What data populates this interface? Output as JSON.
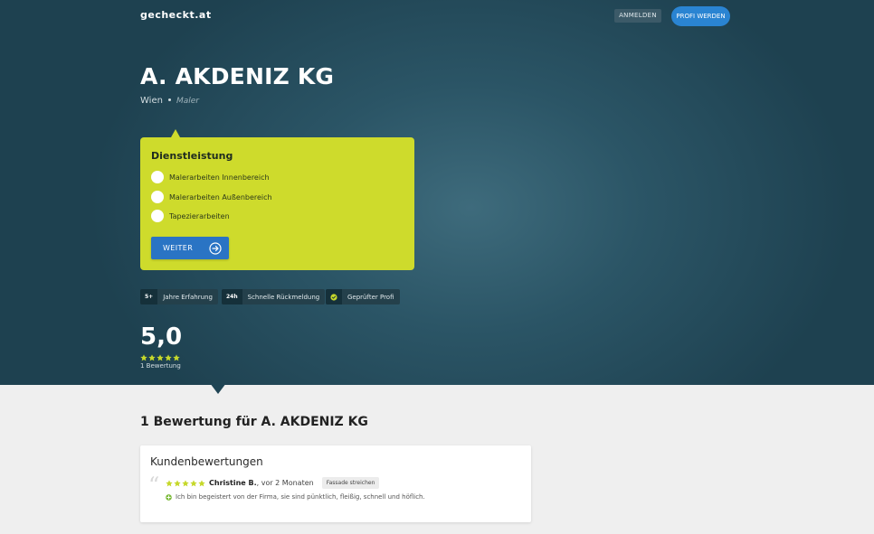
{
  "header": {
    "logo": "gecheckt.at",
    "login_label": "ANMELDEN",
    "pro_label": "PROFI WERDEN"
  },
  "company": {
    "name": "A. AKDENIZ KG",
    "city": "Wien",
    "category": "Maler"
  },
  "service_form": {
    "title": "Dienstleistung",
    "options": [
      {
        "label": "Malerarbeiten Innenbereich"
      },
      {
        "label": "Malerarbeiten Außenbereich"
      },
      {
        "label": "Tapezierarbeiten"
      }
    ],
    "submit_label": "WEITER"
  },
  "badges": [
    {
      "key": "5+",
      "label": "Jahre Erfahrung"
    },
    {
      "key": "24h",
      "label": "Schnelle Rückmeldung"
    },
    {
      "key": "check-icon",
      "label": "Geprüfter Profi"
    }
  ],
  "rating": {
    "score": "5,0",
    "stars": 5,
    "count_label": "1 Bewertung"
  },
  "reviews_section": {
    "title": "1 Bewertung für A. AKDENIZ KG",
    "card_heading": "Kundenbewertungen",
    "reviews": [
      {
        "stars": 5,
        "author": "Christine B.",
        "time": ", vor 2 Monaten",
        "tag": "Fassade streichen",
        "text": "Ich bin begeistert von der Firma, sie sind pünktlich, fleißig, schnell und höflich."
      }
    ]
  },
  "colors": {
    "accent_lime": "#cedb2c",
    "button_blue": "#2a74c4",
    "pro_blue": "#2a84d2",
    "star_lime": "#c6d82b",
    "hero_dark": "#1e4150"
  }
}
